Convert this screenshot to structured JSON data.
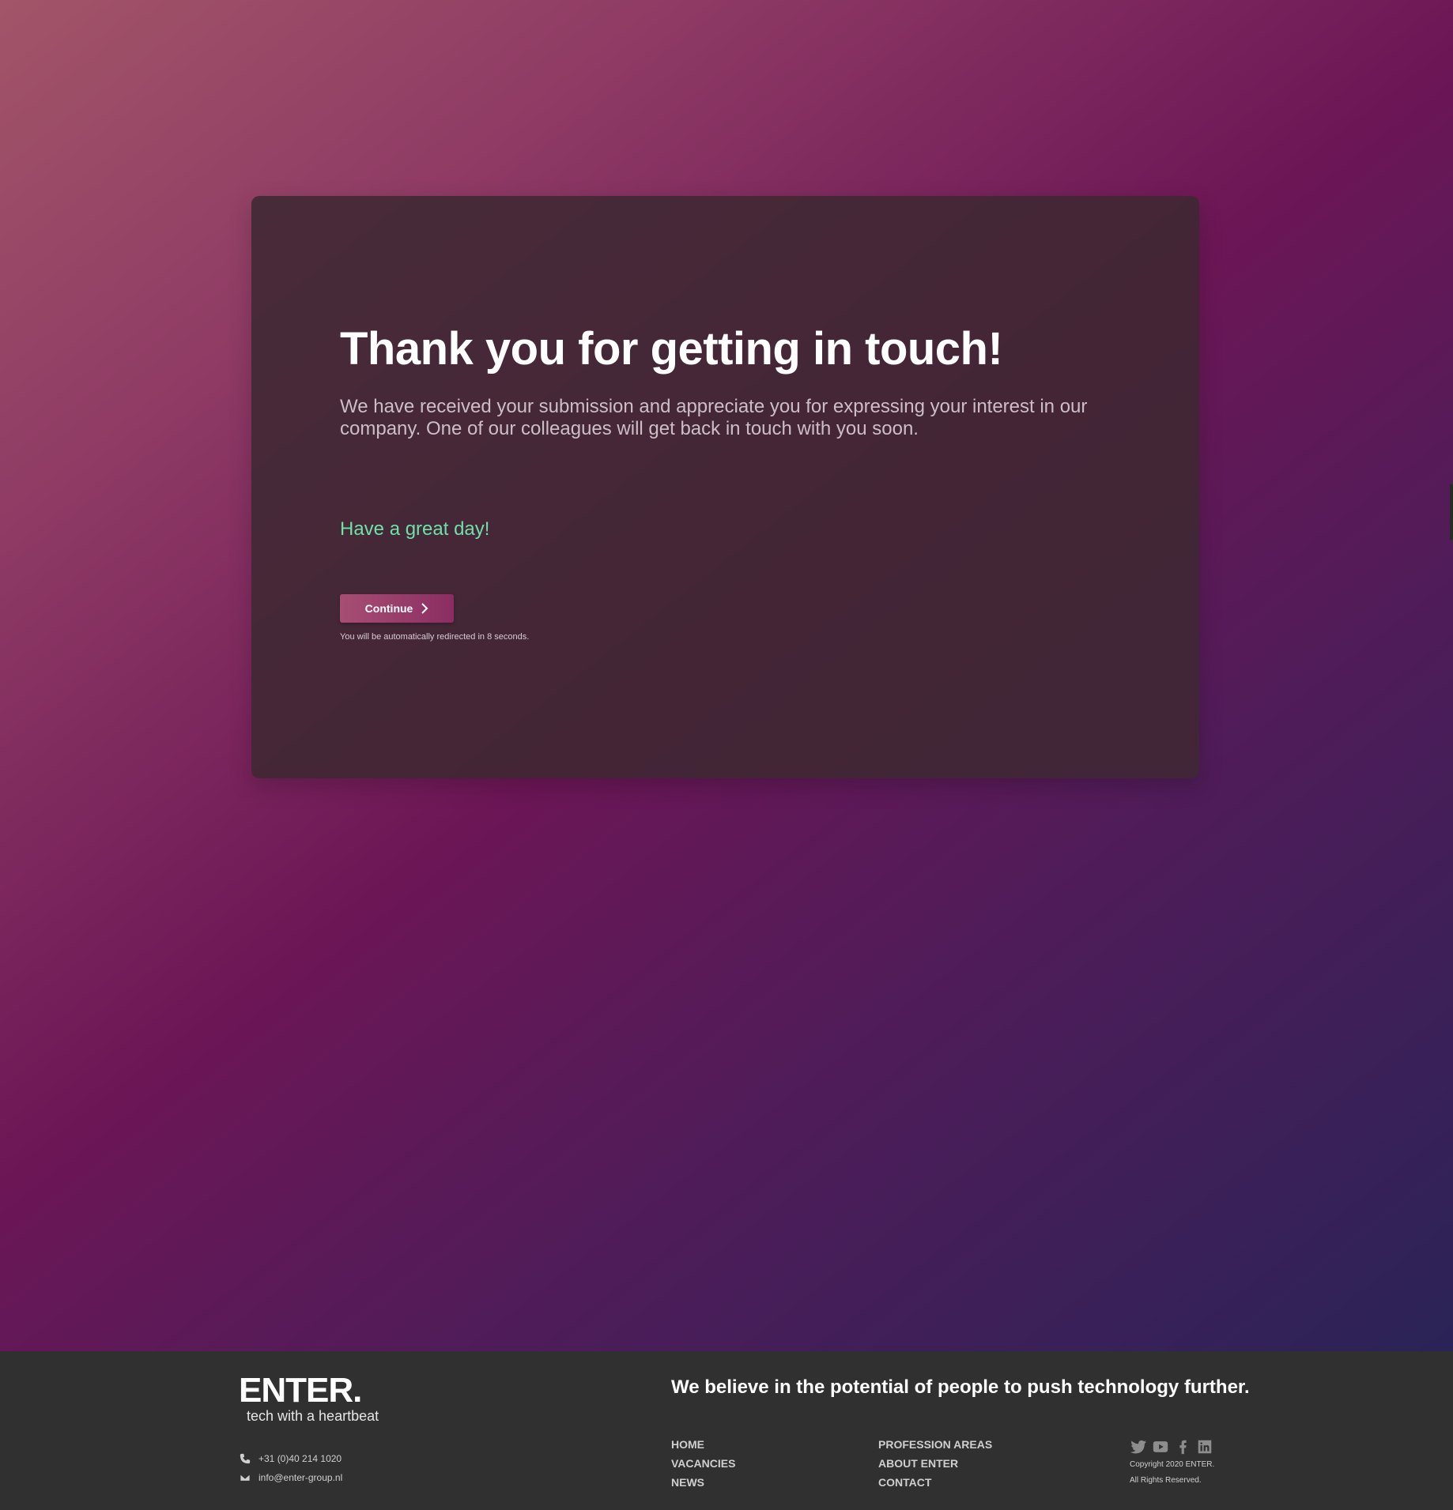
{
  "card": {
    "title": "Thank you for getting in touch!",
    "subtitle": "We have received your submission and appreciate you for expressing your interest in our company. One of our colleagues will get back in touch with you soon.",
    "greeting": "Have a great day!",
    "continue_label": "Continue",
    "redirect_note": "You will be automatically redirected in 8 seconds."
  },
  "footer": {
    "logo_text": "ENTER.",
    "logo_tagline": "tech with a heartbeat",
    "phone": "+31 (0)40 214 1020",
    "email": "info@enter-group.nl",
    "slogan": "We believe in the potential of people to push technology further.",
    "nav_col1": [
      "HOME",
      "VACANCIES",
      "NEWS"
    ],
    "nav_col2": [
      "PROFESSION AREAS",
      "ABOUT ENTER",
      "CONTACT"
    ],
    "social_icons": [
      "twitter-icon",
      "youtube-icon",
      "facebook-icon",
      "linkedin-icon"
    ],
    "copyright_line1": "Copyright 2020 ENTER.",
    "copyright_line2": "All Rights Reserved."
  },
  "colors": {
    "greeting": "#6fe0a8",
    "footer_bg": "#303030",
    "button_start": "#a74e74",
    "button_end": "#8a2e62"
  }
}
